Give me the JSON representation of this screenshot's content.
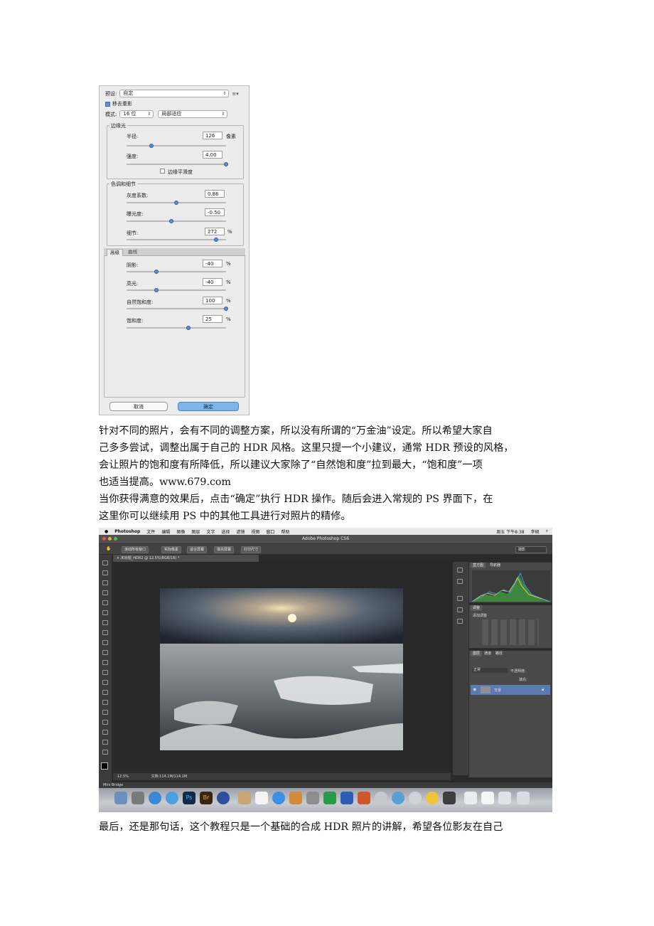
{
  "hdr_dialog": {
    "preset_label": "预设:",
    "preset_value": "自定",
    "remove_ghosts_label": "移去重影",
    "mode_label": "模式:",
    "mode_bits": "16 位",
    "mode_method": "局部适应",
    "edge_glow": {
      "title": "边缘光",
      "radius_label": "半径:",
      "radius_value": "126",
      "radius_unit": "像素",
      "strength_label": "强度:",
      "strength_value": "4.00",
      "smooth_edges_label": "边缘平滑度"
    },
    "tone_detail": {
      "title": "色调和细节",
      "gamma_label": "灰度系数:",
      "gamma_value": "0.86",
      "exposure_label": "曝光度:",
      "exposure_value": "-0.50",
      "detail_label": "细节:",
      "detail_value": "272",
      "detail_unit": "%"
    },
    "tabs": [
      "高级",
      "曲线"
    ],
    "advanced": {
      "shadow_label": "阴影:",
      "shadow_value": "-40",
      "shadow_unit": "%",
      "highlight_label": "高光:",
      "highlight_value": "-40",
      "highlight_unit": "%",
      "vibrance_label": "自然饱和度:",
      "vibrance_value": "100",
      "vibrance_unit": "%",
      "saturation_label": "饱和度:",
      "saturation_value": "25",
      "saturation_unit": "%"
    },
    "slider_levels": {
      "radius": 0.25,
      "strength": 1.0,
      "gamma": 0.5,
      "exposure": 0.45,
      "detail": 0.9,
      "shadow": 0.3,
      "highlight": 0.3,
      "vibrance": 1.0,
      "saturation": 0.62
    },
    "cancel_label": "取消",
    "ok_label": "确定"
  },
  "paragraph1": [
    "针对不同的照片，会有不同的调整方案，所以没有所谓的“万金油”设定。所以希望大家自",
    "己多多尝试，调整出属于自己的 HDR 风格。这里只提一个小建议，通常 HDR 预设的风格，",
    "会让照片的饱和度有所降低，所以建议大家除了“自然饱和度”拉到最大，“饱和度”一项",
    "也适当提高。www.679.com"
  ],
  "paragraph2": [
    "当你获得满意的效果后，点击“确定”执行 HDR 操作。随后会进入常规的 PS 界面下，在",
    "这里你可以继续用 PS 中的其他工具进行对照片的精修。"
  ],
  "paragraph3": [
    "最后，还是那句话，这个教程只是一个基础的合成 HDR 照片的讲解，希望各位影友在自己"
  ],
  "photoshop": {
    "menu": [
      "Photoshop",
      "文件",
      "编辑",
      "图像",
      "图层",
      "文字",
      "选择",
      "滤镜",
      "视图",
      "窗口",
      "帮助"
    ],
    "clock": "周五 下午8:38",
    "user": "李硕",
    "window_title": "Adobe Photoshop CS6",
    "option_buttons": [
      "滚动所有窗口",
      "实际像素",
      "适合屏幕",
      "填充屏幕",
      "打印尺寸"
    ],
    "workspace": "摄影",
    "doc_tab": "× 未标题_HDR2 @ 12.5%(RGB/16) *",
    "zoom": "12.5%",
    "doc_size": "文档:114.1M/114.1M",
    "mini_bridge": "Mini Bridge",
    "histogram_tabs": [
      "直方图",
      "导航器"
    ],
    "adjust_tab": "调整",
    "adjust_title": "添加调整",
    "layers_tabs": [
      "图层",
      "通道",
      "路径"
    ],
    "blend_mode": "正常",
    "opacity_label": "不透明度:",
    "fill_label": "填充:",
    "layer_name": "背景",
    "colors": {
      "dialog_bg": "#ececec",
      "ok_button": "#7fb4ea",
      "ps_bg": "#2a2a2a",
      "slider_thumb": "#5c8fd4"
    }
  }
}
